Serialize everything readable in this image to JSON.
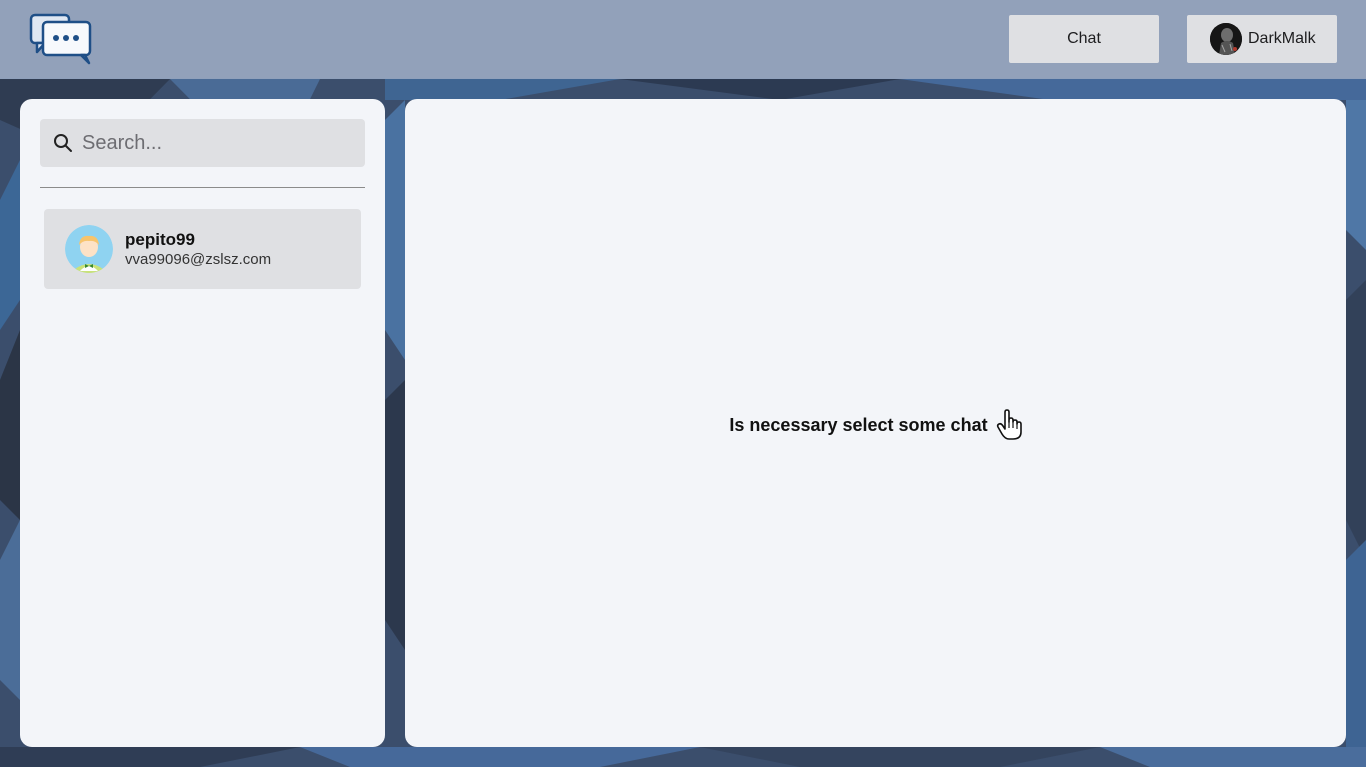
{
  "header": {
    "logo_icon": "chat-bubbles-logo-icon",
    "chat_button_label": "Chat",
    "user_button_label": "DarkMalk"
  },
  "sidebar": {
    "search": {
      "placeholder": "Search...",
      "value": ""
    },
    "contacts": [
      {
        "name": "pepito99",
        "email": "vva99096@zslsz.com",
        "avatar_icon": "avatar-icon"
      }
    ]
  },
  "main": {
    "empty_message": "Is necessary select some chat",
    "hint_icon": "pointing-hand-icon"
  },
  "colors": {
    "header_bg": "#aab9d0",
    "panel_bg": "#f3f5f9",
    "button_bg": "#dfe0e3",
    "page_bg": "#3d5272"
  }
}
